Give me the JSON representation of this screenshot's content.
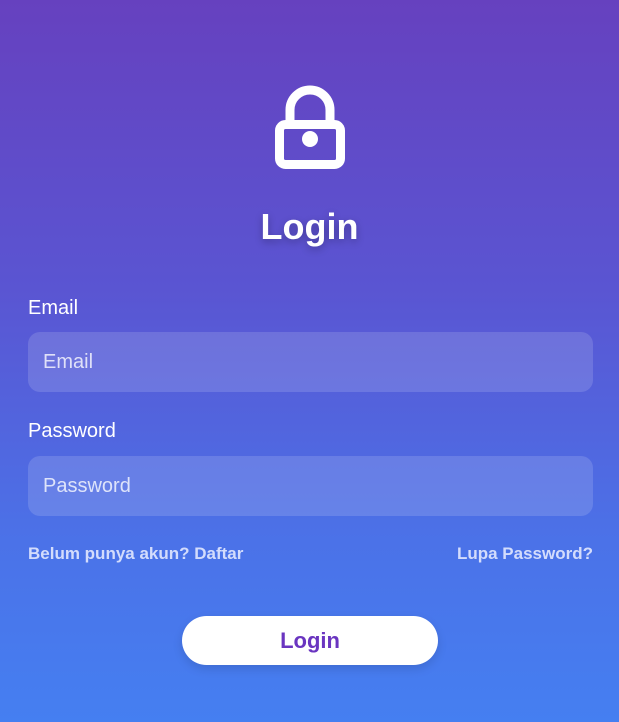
{
  "icons": {
    "lock": "lock-icon"
  },
  "colors": {
    "gradient_top": "#6641bf",
    "gradient_bottom": "#457ff1",
    "button_text": "#6a35c0",
    "button_bg": "#ffffff"
  },
  "header": {
    "title": "Login"
  },
  "form": {
    "email_label": "Email",
    "email_placeholder": "Email",
    "email_value": "",
    "password_label": "Password",
    "password_placeholder": "Password",
    "password_value": ""
  },
  "links": {
    "register": "Belum punya akun? Daftar",
    "forgot": "Lupa Password?"
  },
  "actions": {
    "login_label": "Login"
  }
}
